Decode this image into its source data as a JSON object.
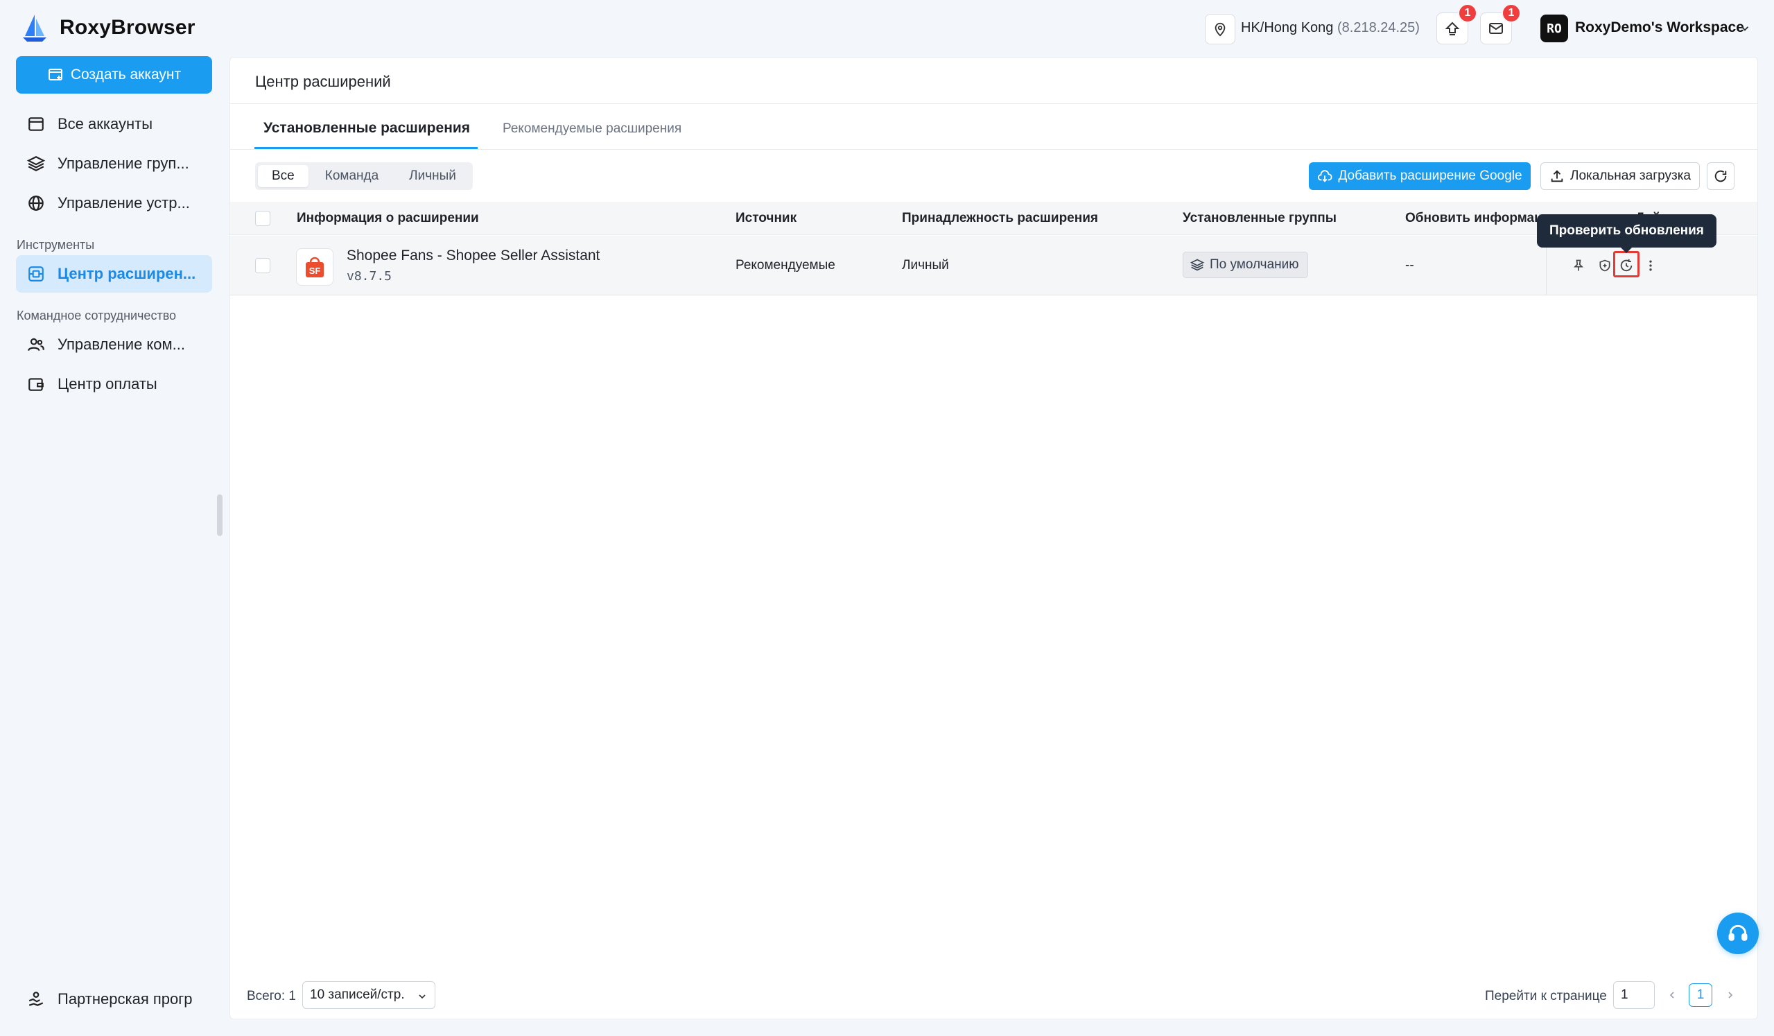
{
  "app": {
    "name": "RoxyBrowser"
  },
  "header": {
    "location": "HK/Hong Kong",
    "ip": "(8.218.24.25)",
    "upload_badge": "1",
    "mail_badge": "1",
    "workspace_initials": "RO",
    "workspace_name": "RoxyDemo's Workspace"
  },
  "sidebar": {
    "create_button": "Создать аккаунт",
    "items": [
      {
        "label": "Все аккаунты",
        "icon": "window-icon"
      },
      {
        "label": "Управление груп...",
        "icon": "layers-icon"
      },
      {
        "label": "Управление устр...",
        "icon": "globe-icon"
      }
    ],
    "tools_label": "Инструменты",
    "tools_items": [
      {
        "label": "Центр расширен...",
        "icon": "extension-icon",
        "active": true
      }
    ],
    "team_label": "Командное сотрудничество",
    "team_items": [
      {
        "label": "Управление ком...",
        "icon": "users-icon"
      },
      {
        "label": "Центр оплаты",
        "icon": "wallet-icon"
      }
    ],
    "partner": "Партнерская прогр"
  },
  "main": {
    "title": "Центр расширений",
    "tabs": [
      {
        "label": "Установленные расширения",
        "active": true
      },
      {
        "label": "Рекомендуемые расширения",
        "active": false
      }
    ],
    "filters": [
      {
        "label": "Все",
        "active": true
      },
      {
        "label": "Команда",
        "active": false
      },
      {
        "label": "Личный",
        "active": false
      }
    ],
    "add_google_button": "Добавить расширение Google",
    "local_upload_button": "Локальная загрузка",
    "table": {
      "columns": [
        "Информация о расширении",
        "Источник",
        "Принадлежность расширения",
        "Установленные группы",
        "Обновить информацию",
        "Действие"
      ],
      "rows": [
        {
          "name": "Shopee Fans - Shopee Seller Assistant",
          "version": "v8.7.5",
          "icon_text": "SF",
          "source": "Рекомендуемые",
          "ownership": "Личный",
          "group": "По умолчанию",
          "update_info": "--"
        }
      ]
    },
    "tooltip": "Проверить обновления",
    "footer": {
      "total": "Всего: 1",
      "page_size": "10 записей/стр.",
      "goto_label": "Перейти к странице",
      "goto_value": "1",
      "current_page": "1"
    }
  },
  "colors": {
    "accent": "#1a9cf0",
    "highlight": "#e53935",
    "badge": "#f03e3e",
    "extension_brand": "#ee4d2d"
  }
}
